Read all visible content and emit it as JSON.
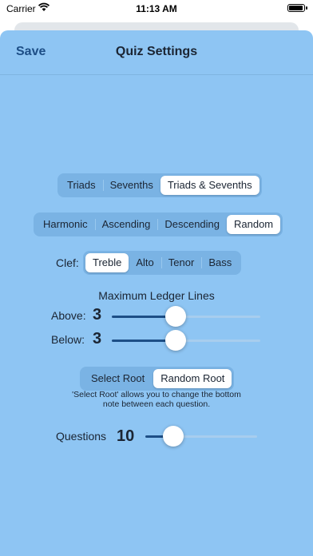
{
  "status_bar": {
    "carrier": "Carrier",
    "time": "11:13 AM"
  },
  "nav": {
    "save_label": "Save",
    "title": "Quiz Settings"
  },
  "chord_type": {
    "options": [
      "Triads",
      "Sevenths",
      "Triads & Sevenths"
    ],
    "selected": "Triads & Sevenths"
  },
  "play_mode": {
    "options": [
      "Harmonic",
      "Ascending",
      "Descending",
      "Random"
    ],
    "selected": "Random"
  },
  "clef": {
    "label": "Clef:",
    "options": [
      "Treble",
      "Alto",
      "Tenor",
      "Bass"
    ],
    "selected": "Treble"
  },
  "ledger": {
    "heading": "Maximum Ledger Lines",
    "above_label": "Above:",
    "above_value": "3",
    "above_fraction": 0.43,
    "below_label": "Below:",
    "below_value": "3",
    "below_fraction": 0.43
  },
  "root": {
    "options": [
      "Select Root",
      "Random Root"
    ],
    "selected": "Random Root",
    "help_text": "'Select Root' allows you to change the bottom note between each question."
  },
  "questions": {
    "label": "Questions",
    "value": "10",
    "fraction": 0.25
  }
}
